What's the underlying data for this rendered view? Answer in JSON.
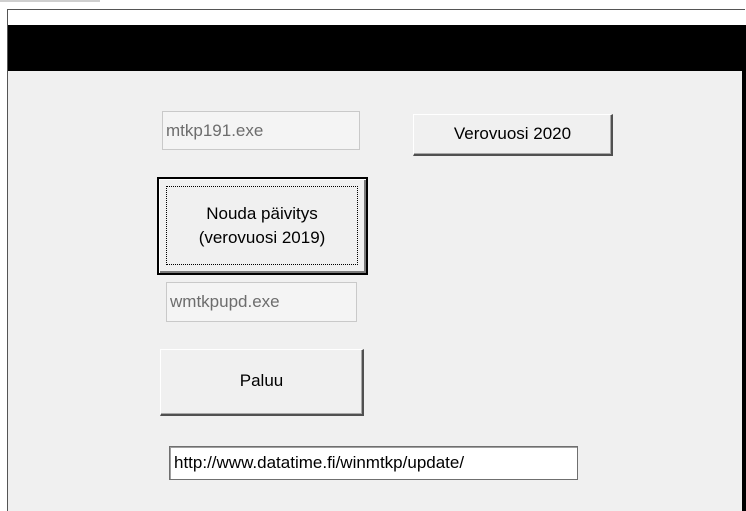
{
  "fields": {
    "installer_file": "mtkp191.exe",
    "update_file": "wmtkpupd.exe",
    "update_url": "http://www.datatime.fi/winmtkp/update/"
  },
  "buttons": {
    "tax_year_2020": "Verovuosi 2020",
    "fetch_update_line1": "Nouda päivitys",
    "fetch_update_line2": "(verovuosi 2019)",
    "back": "Paluu"
  }
}
